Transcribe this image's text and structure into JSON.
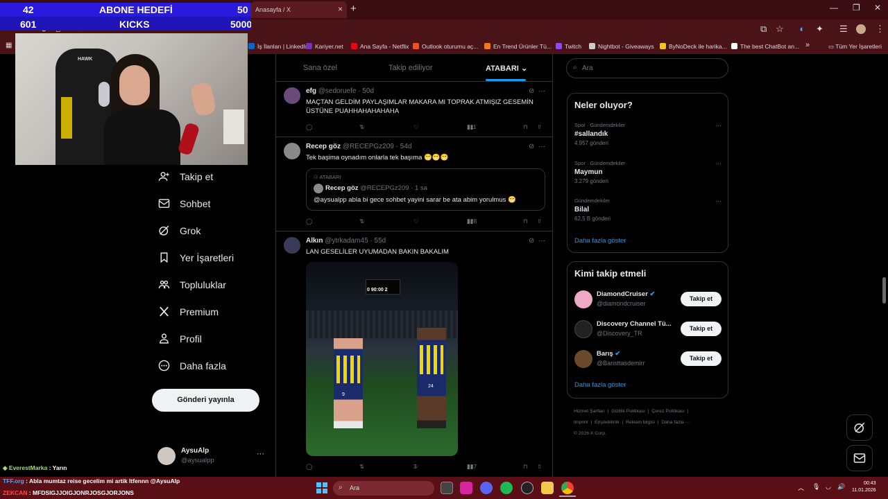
{
  "overlay": {
    "goal_current": "42",
    "goal_title": "ABONE HEDEFİ",
    "goal_target": "50",
    "kicks_current": "601",
    "kicks_title": "KICKS",
    "kicks_target": "5000",
    "webcam_brand": "HAWK"
  },
  "browser": {
    "tab_title": "Anasayfa / X",
    "url": "x.com/home",
    "bookmarks": [
      {
        "label": "İş İlanları | LinkedIn",
        "color": "#0a66c2"
      },
      {
        "label": "Kariyer.net",
        "color": "#7b2fbf"
      },
      {
        "label": "Ana Sayfa - Netflix",
        "color": "#e50914"
      },
      {
        "label": "Outlook oturumu aç...",
        "color": "#f25022"
      },
      {
        "label": "En Trend Ürünler Tü...",
        "color": "#f27a1a"
      },
      {
        "label": "Twitch",
        "color": "#9146ff"
      },
      {
        "label": "Nightbot - Giveaways",
        "color": "#cccccc"
      },
      {
        "label": "ByNoDeck ile harika...",
        "color": "#f5c518"
      },
      {
        "label": "The best ChatBot an...",
        "color": "#ffffff"
      }
    ],
    "bookmarks_overflow": "»",
    "all_bookmarks": "Tüm Yer İşaretleri"
  },
  "nav": {
    "items": [
      {
        "label": "Takip et",
        "icon": "follow-icon"
      },
      {
        "label": "Sohbet",
        "icon": "mail-icon"
      },
      {
        "label": "Grok",
        "icon": "grok-icon"
      },
      {
        "label": "Yer İşaretleri",
        "icon": "bookmark-icon"
      },
      {
        "label": "Topluluklar",
        "icon": "communities-icon"
      },
      {
        "label": "Premium",
        "icon": "x-logo-icon"
      },
      {
        "label": "Profil",
        "icon": "profile-icon"
      },
      {
        "label": "Daha fazla",
        "icon": "more-circle-icon"
      }
    ],
    "post_button": "Gönderi yayınla",
    "account_name": "AysuAlp",
    "account_handle": "@aysualpp",
    "account_menu": "···"
  },
  "feed": {
    "tabs": [
      "Sana özel",
      "Takip ediliyor",
      "ATABARI"
    ],
    "tweets": [
      {
        "name": "efg",
        "handle": "@sedoruefe · 50d",
        "text": "MAÇTAN GELDİM PAYLAŞIMLAR MAKARA MI TOPRAK ATMIŞIZ GESEMİN ÜSTÜNE PUAHHAHAHAHAHA",
        "views": "211",
        "likes": "",
        "avatar_color": "#6a4a7a"
      },
      {
        "name": "Recep göz",
        "handle": "@RECEPGz209 · 54d",
        "text": "Tek başima oynadım onlarla tek başıma 😁😁😁",
        "quote": {
          "context": "ATABARI",
          "name": "Recep göz",
          "handle": "@RECEPGz209 · 1 sa",
          "text": "@aysualpp  abla bi gece sohbet yayini sarar be ata abim yorulmus 😁"
        },
        "views": "328",
        "likes": "",
        "avatar_color": "#8a8a8a"
      },
      {
        "name": "Alkın",
        "handle": "@ytrkadam45 · 55d",
        "text": "LAN GESELİLER UYUMADAN BAKIN BAKALIM",
        "scoreboard": "0  90:00  2",
        "player_numbers": [
          "9",
          "24"
        ],
        "views": "237",
        "likes": "3",
        "avatar_color": "#3a3a5a"
      }
    ]
  },
  "sidebar": {
    "search_placeholder": "Ara",
    "trends_title": "Neler oluyor?",
    "trends": [
      {
        "context": "Spor · Gündemdekiler",
        "topic": "#sallandık",
        "count": "4.957 gönderi"
      },
      {
        "context": "Spor · Gündemdekiler",
        "topic": "Maymun",
        "count": "3.279 gönderi"
      },
      {
        "context": "Gündemdekiler",
        "topic": "Bilal",
        "count": "62,5 B gönderi"
      }
    ],
    "trends_more": "Daha fazla göster",
    "follow_title": "Kimi takip etmeli",
    "suggestions": [
      {
        "name": "DiamondCruiser",
        "handle": "@diamondcruiser",
        "verified": true,
        "avatar_color": "#f0a8c8"
      },
      {
        "name": "Discovery Channel Tü...",
        "handle": "@Discovery_TR",
        "verified": false,
        "avatar_color": "#222222"
      },
      {
        "name": "Barış",
        "handle": "@Baristtasdemirr",
        "verified": true,
        "avatar_color": "#6a4a2a"
      }
    ],
    "follow_button": "Takip et",
    "follow_more": "Daha fazla göster",
    "footer": [
      "Hizmet Şartları",
      "Gizlilik Politikası",
      "Çerez Politikası",
      "Imprint",
      "Erişilebilirlik",
      "Reklam bilgisi",
      "Daha fazla ···",
      "© 2026 X Corp."
    ]
  },
  "chat": [
    {
      "user": "EverestMarka",
      "text": ": Yarın",
      "color": "#9be07a"
    },
    {
      "user": "TFF.org",
      "text": ": Abla mumtaz reise gecelim mi artik ltfennn @AysuAlp",
      "color": "#4aa8ff"
    },
    {
      "user": "ZEKCAN",
      "text": ": MFDSIGJJOIGJONRJOSGJORJONS",
      "color": "#ff4a4a"
    }
  ],
  "taskbar": {
    "search": "Ara",
    "time": "00:43",
    "date": "11.01.2026"
  }
}
